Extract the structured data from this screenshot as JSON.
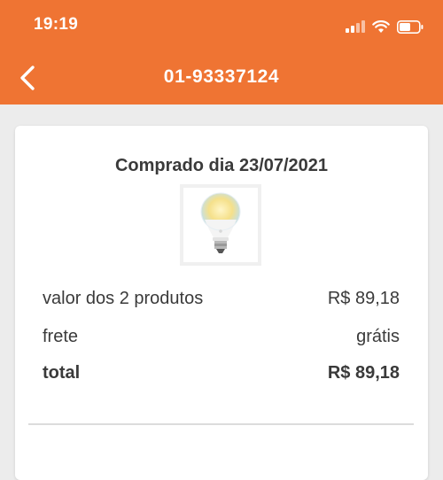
{
  "status_bar": {
    "time": "19:19",
    "icons": [
      "cellular-signal-icon",
      "wifi-icon",
      "battery-icon"
    ]
  },
  "header": {
    "title": "01-93337124",
    "back_icon": "chevron-left-icon",
    "background_color": "#ef7433"
  },
  "order": {
    "purchase_date": "Comprado dia 23/07/2021",
    "product_image": "light-bulb-icon",
    "summary": {
      "products_label": "valor dos 2 produtos",
      "products_value": "R$ 89,18",
      "shipping_label": "frete",
      "shipping_value": "grátis",
      "total_label": "total",
      "total_value": "R$ 89,18"
    }
  }
}
